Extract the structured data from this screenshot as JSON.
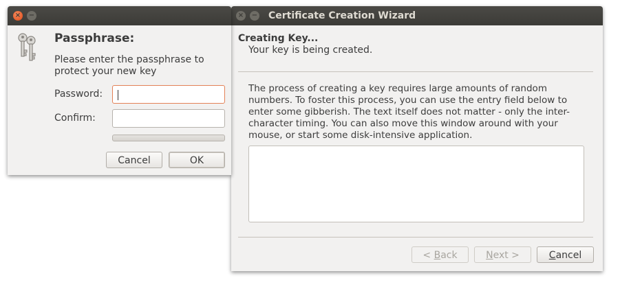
{
  "passphrase_dialog": {
    "title": "",
    "heading": "Passphrase:",
    "description": "Please enter the passphrase to protect your new key",
    "password_label": "Password:",
    "password_value": "",
    "confirm_label": "Confirm:",
    "confirm_value": "",
    "strength_progress": 0,
    "cancel_label": "Cancel",
    "ok_label": "OK",
    "icon": "keys-icon"
  },
  "wizard": {
    "title": "Certificate Creation Wizard",
    "page_title": "Creating Key...",
    "page_subtitle": "Your key is being created.",
    "body_text": "The process of creating a key requires large amounts of random numbers. To foster this process, you can use the entry field below to enter some gibberish. The text itself does not matter - only the inter-character timing. You can also move this window around with your mouse, or start some disk-intensive application.",
    "gibberish_value": "",
    "back_prefix": "< ",
    "back_mnemonic": "B",
    "back_rest": "ack",
    "next_mnemonic": "N",
    "next_rest": "ext >",
    "cancel_mnemonic": "C",
    "cancel_rest": "ancel"
  },
  "colors": {
    "titlebar": "#3c3b37",
    "close_button": "#df4a16",
    "focus_border": "#e38055",
    "window_bg": "#f2f1f0"
  }
}
